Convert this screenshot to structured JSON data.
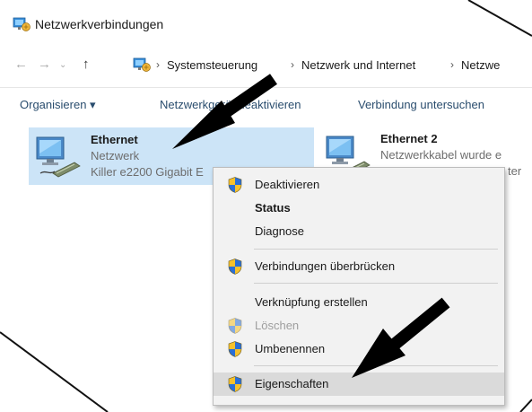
{
  "window": {
    "title": "Netzwerkverbindungen",
    "title_icon": "network-folder-icon"
  },
  "navigation": {
    "back_icon": "back-arrow-icon",
    "forward_icon": "forward-arrow-icon",
    "recent_icon": "chevron-down-icon",
    "up_icon": "up-arrow-icon"
  },
  "breadcrumb": {
    "icon": "control-panel-icon",
    "items": [
      "Systemsteuerung",
      "Netzwerk und Internet",
      "Netzwe"
    ],
    "separator": "›"
  },
  "toolbar": {
    "organize_label": "Organisieren ▾",
    "disable_label": "Netzwerkgerät deaktivieren",
    "diagnose_label": "Verbindung untersuchen"
  },
  "adapters": [
    {
      "name": "Ethernet",
      "status": "Netzwerk",
      "device": "Killer e2200 Gigabit E",
      "icon": "ethernet-adapter-icon",
      "selected": true
    },
    {
      "name": "Ethernet 2",
      "status": "Netzwerkkabel wurde e",
      "device": "ter",
      "icon": "ethernet-adapter-icon",
      "selected": false
    }
  ],
  "context_menu": {
    "items": [
      {
        "label": "Deaktivieren",
        "icon": "uac-shield-icon"
      },
      {
        "label": "Status",
        "icon": ""
      },
      {
        "label": "Diagnose",
        "icon": ""
      },
      {
        "label": "Verbindungen überbrücken",
        "icon": "uac-shield-icon"
      },
      {
        "label": "Verknüpfung erstellen",
        "icon": ""
      },
      {
        "label": "Löschen",
        "icon": "uac-shield-icon"
      },
      {
        "label": "Umbenennen",
        "icon": "uac-shield-icon"
      },
      {
        "label": "Eigenschaften",
        "icon": "uac-shield-icon"
      }
    ]
  },
  "colors": {
    "selection": "#cce4f7",
    "toolbar_text": "#2a4d6e",
    "menu_background": "#f2f2f2",
    "menu_highlight": "#dadada",
    "annotation_arrow": "#000000"
  }
}
